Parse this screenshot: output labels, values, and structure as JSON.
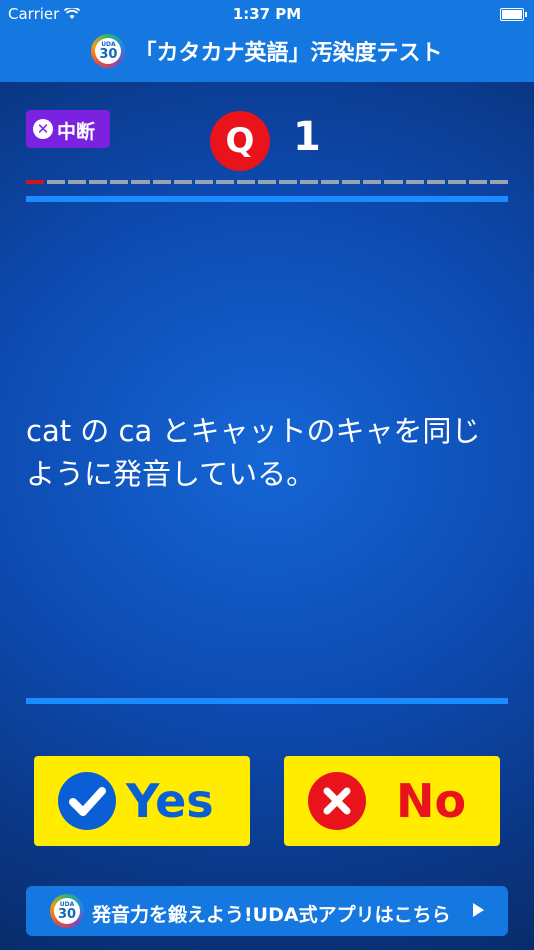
{
  "status_bar": {
    "carrier": "Carrier",
    "time": "1:37 PM"
  },
  "header": {
    "logo_top": "UDA",
    "logo_num": "30",
    "title": "「カタカナ英語」汚染度テスト"
  },
  "quit_button": {
    "label": "中断"
  },
  "question_header": {
    "badge": "Q",
    "number": "1"
  },
  "progress": {
    "current": 1,
    "total": 23
  },
  "question": {
    "text": "cat の ca とキャットのキャを同じように発音している。"
  },
  "answers": {
    "yes_label": "Yes",
    "no_label": "No"
  },
  "promo": {
    "logo_top": "UDA",
    "logo_num": "30",
    "text": "発音力を鍛えよう!UDA式アプリはこちら"
  },
  "colors": {
    "header_blue": "#1578e0",
    "quit_purple": "#7b22e0",
    "q_red": "#e8131b",
    "answer_yellow": "#ffec00",
    "yes_blue": "#0b5fd6",
    "no_red": "#e8131b",
    "progress_done": "#c9181e"
  }
}
